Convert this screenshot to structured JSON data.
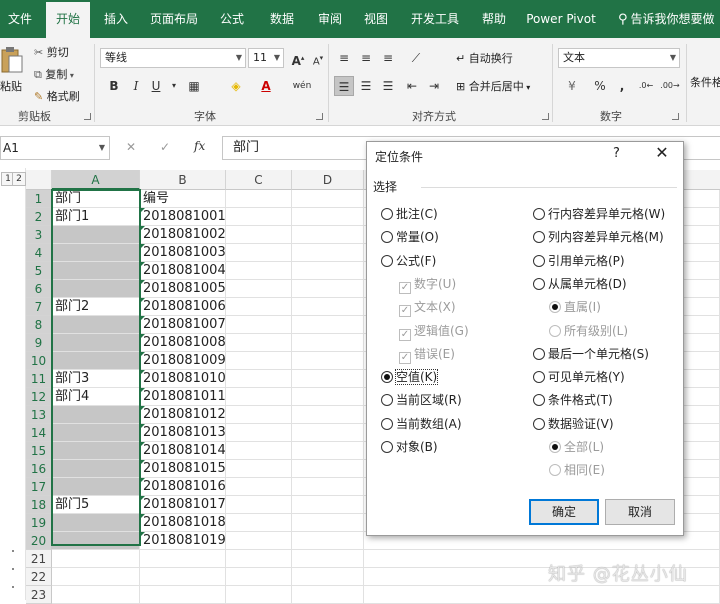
{
  "ribbon_tabs": [
    "文件",
    "开始",
    "插入",
    "页面布局",
    "公式",
    "数据",
    "审阅",
    "视图",
    "开发工具",
    "帮助",
    "Power Pivot"
  ],
  "active_tab": "开始",
  "tell_me": "告诉我你想要做",
  "clipboard": {
    "paste": "粘贴",
    "cut": "剪切",
    "copy": "复制",
    "format_painter": "格式刷",
    "label": "剪贴板"
  },
  "font": {
    "name": "等线",
    "size": "11",
    "bold": "B",
    "italic": "I",
    "underline": "U",
    "label": "字体",
    "grow": "A",
    "shrink": "A",
    "phonetic": "wén"
  },
  "alignment": {
    "wrap": "自动换行",
    "merge": "合并后居中",
    "label": "对齐方式"
  },
  "number": {
    "format": "文本",
    "percent": "%",
    "comma": ",",
    "label": "数字"
  },
  "styles": {
    "conditional": "条件格"
  },
  "name_box": "A1",
  "formula_value": "部门",
  "columns": [
    "A",
    "B",
    "C",
    "D"
  ],
  "outline_levels": [
    "1",
    "2"
  ],
  "rows": [
    {
      "n": "1",
      "a": "部门",
      "b": "编号"
    },
    {
      "n": "2",
      "a": "部门1",
      "b": "2018081001"
    },
    {
      "n": "3",
      "a": "",
      "b": "2018081002"
    },
    {
      "n": "4",
      "a": "",
      "b": "2018081003"
    },
    {
      "n": "5",
      "a": "",
      "b": "2018081004"
    },
    {
      "n": "6",
      "a": "",
      "b": "2018081005"
    },
    {
      "n": "7",
      "a": "部门2",
      "b": "2018081006"
    },
    {
      "n": "8",
      "a": "",
      "b": "2018081007"
    },
    {
      "n": "9",
      "a": "",
      "b": "2018081008"
    },
    {
      "n": "10",
      "a": "",
      "b": "2018081009"
    },
    {
      "n": "11",
      "a": "部门3",
      "b": "2018081010"
    },
    {
      "n": "12",
      "a": "部门4",
      "b": "2018081011"
    },
    {
      "n": "13",
      "a": "",
      "b": "2018081012"
    },
    {
      "n": "14",
      "a": "",
      "b": "2018081013"
    },
    {
      "n": "15",
      "a": "",
      "b": "2018081014"
    },
    {
      "n": "16",
      "a": "",
      "b": "2018081015"
    },
    {
      "n": "17",
      "a": "",
      "b": "2018081016"
    },
    {
      "n": "18",
      "a": "部门5",
      "b": "2018081017"
    },
    {
      "n": "19",
      "a": "",
      "b": "2018081018"
    },
    {
      "n": "20",
      "a": "",
      "b": "2018081019"
    },
    {
      "n": "21",
      "a": "",
      "b": ""
    },
    {
      "n": "22",
      "a": "",
      "b": ""
    },
    {
      "n": "23",
      "a": "",
      "b": ""
    }
  ],
  "dialog": {
    "title": "定位条件",
    "help": "?",
    "close": "✕",
    "group": "选择",
    "left_options": [
      {
        "label": "批注(C)",
        "checked": false,
        "disabled": false,
        "kind": "radio"
      },
      {
        "label": "常量(O)",
        "checked": false,
        "disabled": false,
        "kind": "radio"
      },
      {
        "label": "公式(F)",
        "checked": false,
        "disabled": false,
        "kind": "radio"
      },
      {
        "label": "数字(U)",
        "checked": true,
        "disabled": true,
        "kind": "check"
      },
      {
        "label": "文本(X)",
        "checked": true,
        "disabled": true,
        "kind": "check"
      },
      {
        "label": "逻辑值(G)",
        "checked": true,
        "disabled": true,
        "kind": "check"
      },
      {
        "label": "错误(E)",
        "checked": true,
        "disabled": true,
        "kind": "check"
      },
      {
        "label": "空值(K)",
        "checked": true,
        "disabled": false,
        "kind": "radio"
      },
      {
        "label": "当前区域(R)",
        "checked": false,
        "disabled": false,
        "kind": "radio"
      },
      {
        "label": "当前数组(A)",
        "checked": false,
        "disabled": false,
        "kind": "radio"
      },
      {
        "label": "对象(B)",
        "checked": false,
        "disabled": false,
        "kind": "radio"
      }
    ],
    "right_options": [
      {
        "label": "行内容差异单元格(W)",
        "checked": false,
        "disabled": false
      },
      {
        "label": "列内容差异单元格(M)",
        "checked": false,
        "disabled": false
      },
      {
        "label": "引用单元格(P)",
        "checked": false,
        "disabled": false
      },
      {
        "label": "从属单元格(D)",
        "checked": false,
        "disabled": false
      },
      {
        "label": "直属(I)",
        "checked": true,
        "disabled": true
      },
      {
        "label": "所有级别(L)",
        "checked": false,
        "disabled": true
      },
      {
        "label": "最后一个单元格(S)",
        "checked": false,
        "disabled": false
      },
      {
        "label": "可见单元格(Y)",
        "checked": false,
        "disabled": false
      },
      {
        "label": "条件格式(T)",
        "checked": false,
        "disabled": false
      },
      {
        "label": "数据验证(V)",
        "checked": false,
        "disabled": false
      },
      {
        "label": "全部(L)",
        "checked": true,
        "disabled": true
      },
      {
        "label": "相同(E)",
        "checked": false,
        "disabled": true
      }
    ],
    "ok": "确定",
    "cancel": "取消"
  },
  "watermark": "知乎 @花丛小仙",
  "colors": {
    "excel_green": "#217346",
    "selection_fill": "#c6c6c6",
    "ok_border": "#0078d7"
  }
}
